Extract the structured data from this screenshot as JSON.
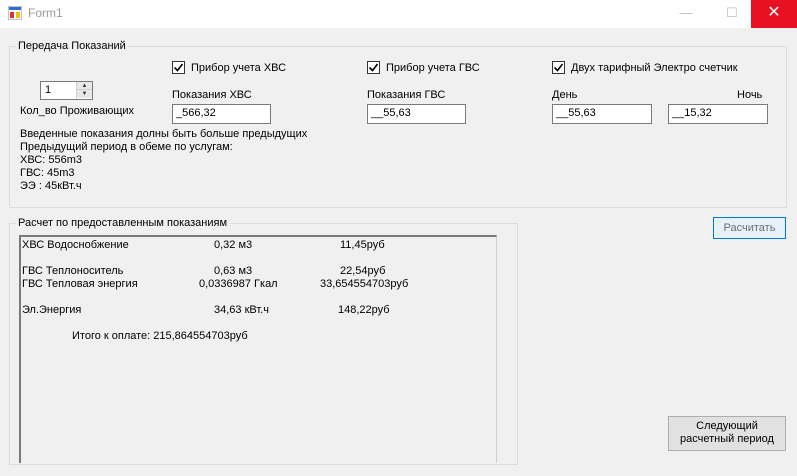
{
  "window": {
    "title": "Form1",
    "minimize": "—",
    "maximize": "☐",
    "close": "✕"
  },
  "group_top": {
    "label": "Передача Показаний",
    "residents": {
      "value": "1",
      "label": "Кол_во Проживающих"
    },
    "hvs": {
      "checkbox_label": "Прибор учета ХВС",
      "checked": true,
      "field_label": "Показания ХВС",
      "value": "_566,32"
    },
    "gvs": {
      "checkbox_label": "Прибор учета ГВС",
      "checked": true,
      "field_label": "Показания ГВС",
      "value": "__55,63"
    },
    "electric": {
      "checkbox_label": "Двух тарифный Электро счетчик",
      "checked": true,
      "day_label": "День",
      "day_value": "__55,63",
      "night_label": "Ночь",
      "night_value": "__15,32"
    },
    "info": [
      "Введенные показания долны быть больше предыдущих",
      "Предыдущий период в обеме по услугам:",
      "ХВС: 556m3",
      "ГВС: 45m3",
      "ЭЭ : 45кВт.ч"
    ]
  },
  "group_bottom": {
    "label": "Расчет по предоставленным показаниям",
    "rows": [
      {
        "name": "ХВС Водоснобжение",
        "volume": "0,32 м3",
        "cost": "11,45руб"
      },
      {
        "name": "ГВС Теплоноситель",
        "volume": "0,63 м3",
        "cost": "22,54руб"
      },
      {
        "name": "ГВС Тепловая энергия",
        "volume": "0,0336987 Гкал",
        "cost": "33,654554703руб"
      },
      {
        "name": "Эл.Энергия",
        "volume": "34,63 кВт.ч",
        "cost": "148,22руб"
      }
    ],
    "total": "Итого к оплате: 215,864554703руб"
  },
  "buttons": {
    "calculate": "Расчитать",
    "next_line1": "Следующий",
    "next_line2": "расчетный период"
  },
  "colors": {
    "accent": "#0078d7",
    "close_red": "#e81123"
  }
}
